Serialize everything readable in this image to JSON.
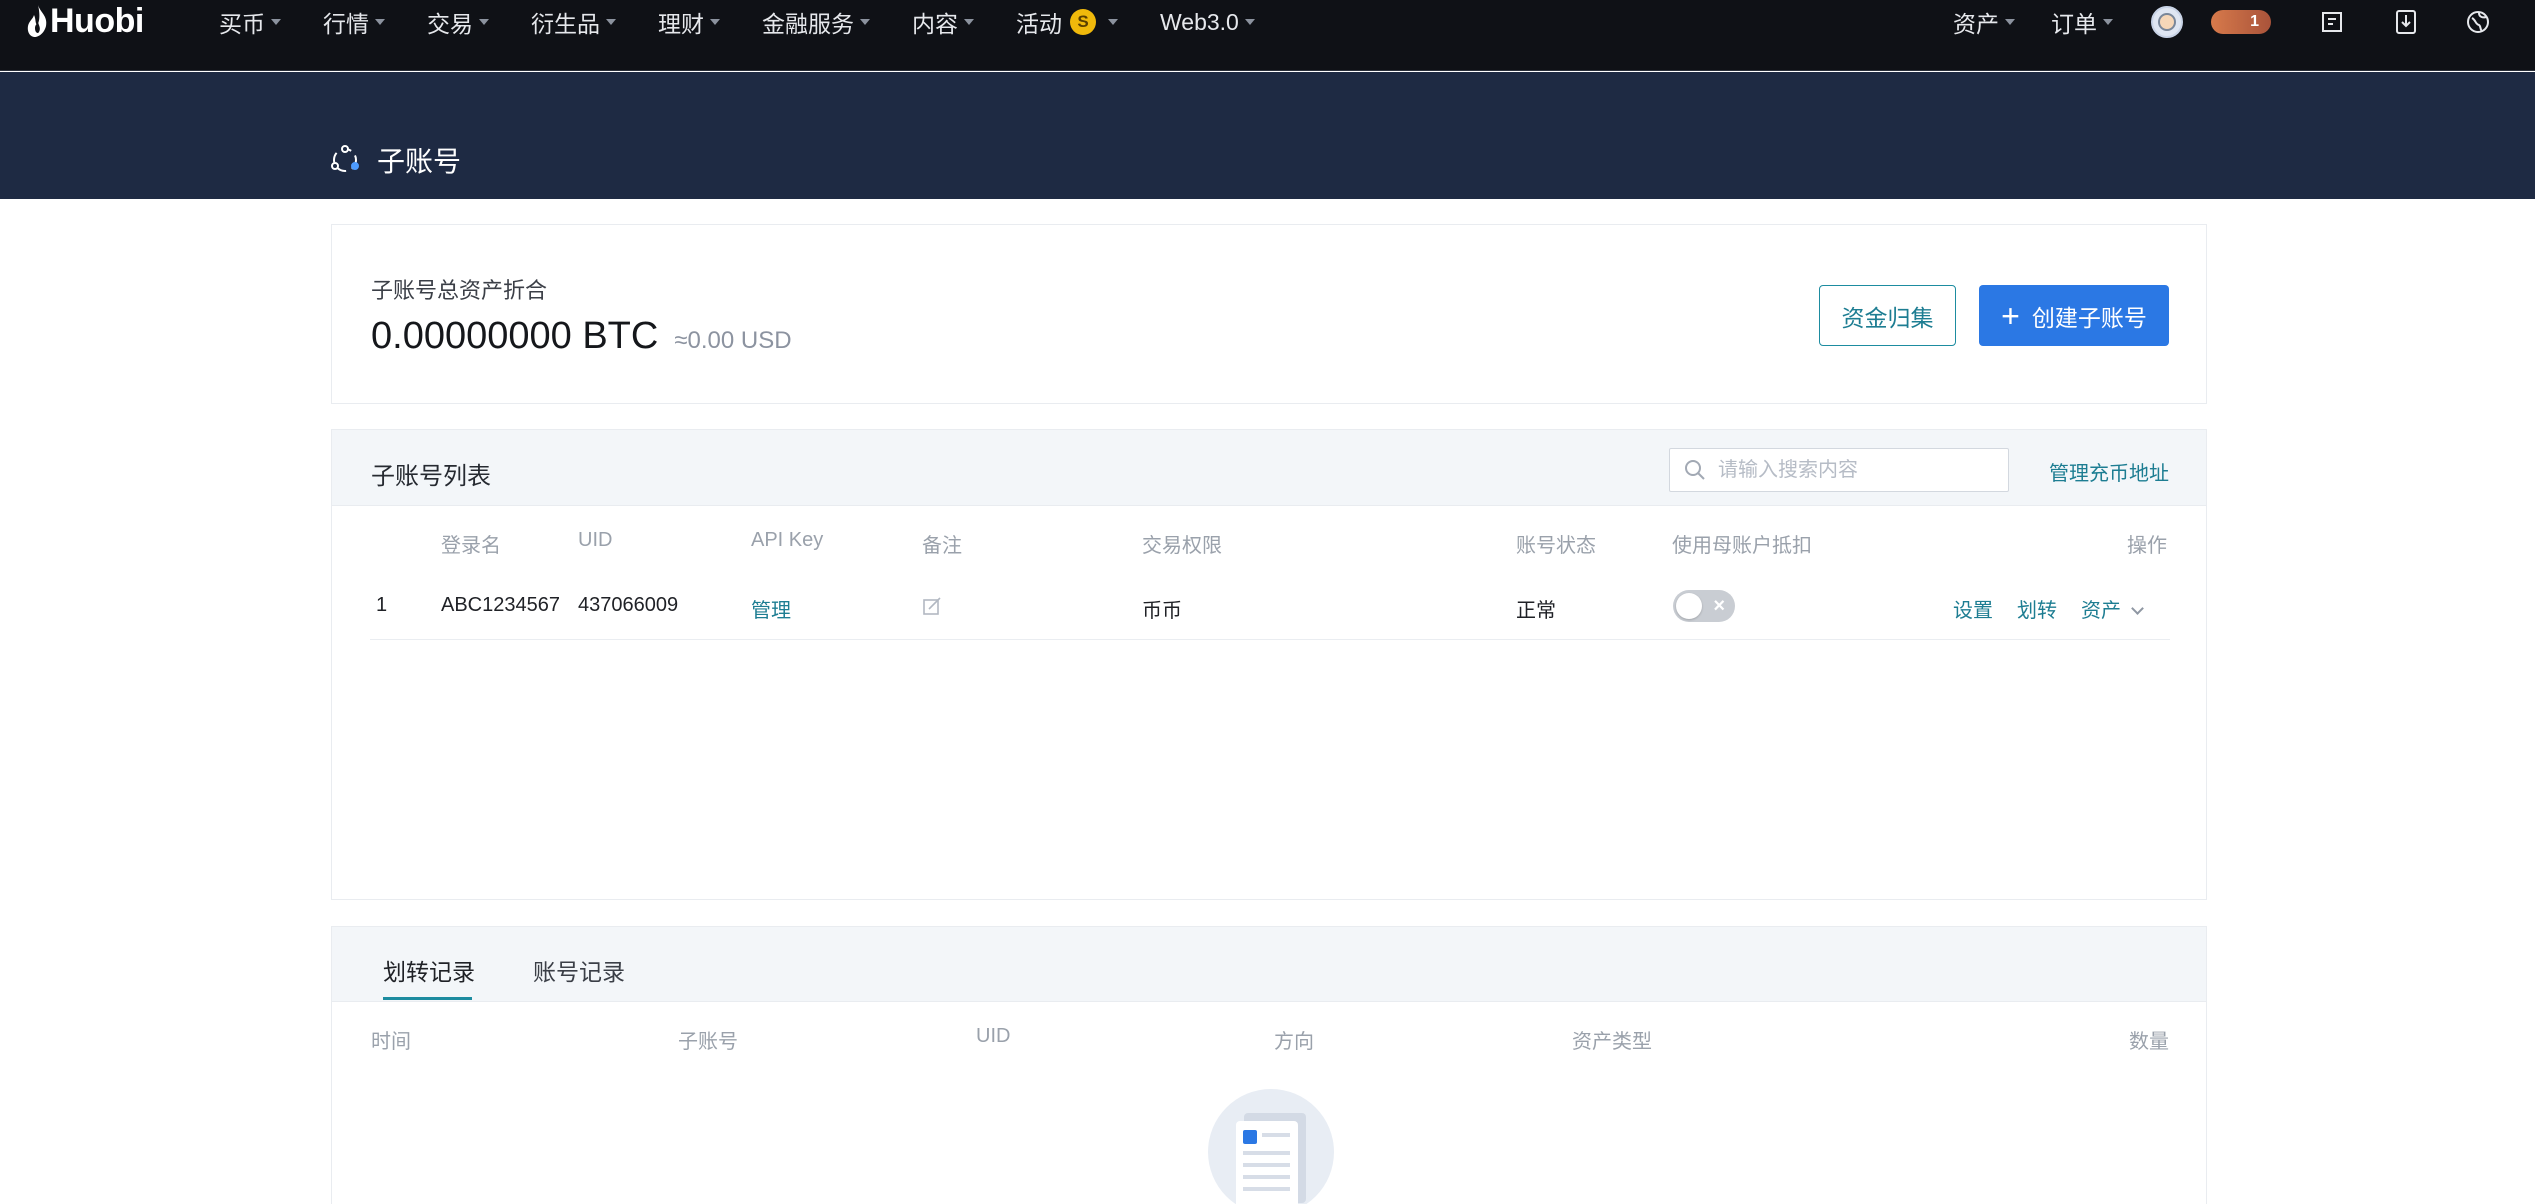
{
  "nav": {
    "logo": "Huobi",
    "menu": [
      {
        "label": "买币",
        "caret": true
      },
      {
        "label": "行情",
        "caret": true
      },
      {
        "label": "交易",
        "caret": true
      },
      {
        "label": "衍生品",
        "caret": true
      },
      {
        "label": "理财",
        "caret": true
      },
      {
        "label": "金融服务",
        "caret": true
      },
      {
        "label": "内容",
        "caret": true
      },
      {
        "label": "活动",
        "caret": true,
        "coin_badge": "S"
      },
      {
        "label": "Web3.0",
        "caret": true
      }
    ],
    "assets": "资产",
    "orders": "订单",
    "badge_count": "1"
  },
  "page": {
    "title": "子账号"
  },
  "summary": {
    "label": "子账号总资产折合",
    "btc": "0.00000000 BTC",
    "usd": "≈0.00 USD",
    "collect_button": "资金归集",
    "create_button": "创建子账号"
  },
  "list": {
    "title": "子账号列表",
    "search_placeholder": "请输入搜索内容",
    "manage_address": "管理充币地址",
    "columns": {
      "login": "登录名",
      "uid": "UID",
      "api": "API Key",
      "note": "备注",
      "perm": "交易权限",
      "status": "账号状态",
      "deduct": "使用母账户抵扣",
      "action": "操作"
    },
    "rows": [
      {
        "index": "1",
        "login": "ABC1234567",
        "uid": "437066009",
        "api": "管理",
        "perm": "币币",
        "status": "正常",
        "deduct_on": false,
        "actions": {
          "settings": "设置",
          "transfer": "划转",
          "assets": "资产"
        }
      }
    ]
  },
  "records": {
    "tabs": [
      "划转记录",
      "账号记录"
    ],
    "active_tab": 0,
    "columns": {
      "time": "时间",
      "sub": "子账号",
      "uid": "UID",
      "direction": "方向",
      "asset_type": "资产类型",
      "amount": "数量"
    }
  },
  "colors": {
    "nav_bg": "#0f1116",
    "band_bg": "#1e2a43",
    "primary": "#2b78e4",
    "link": "#1d7d92"
  }
}
